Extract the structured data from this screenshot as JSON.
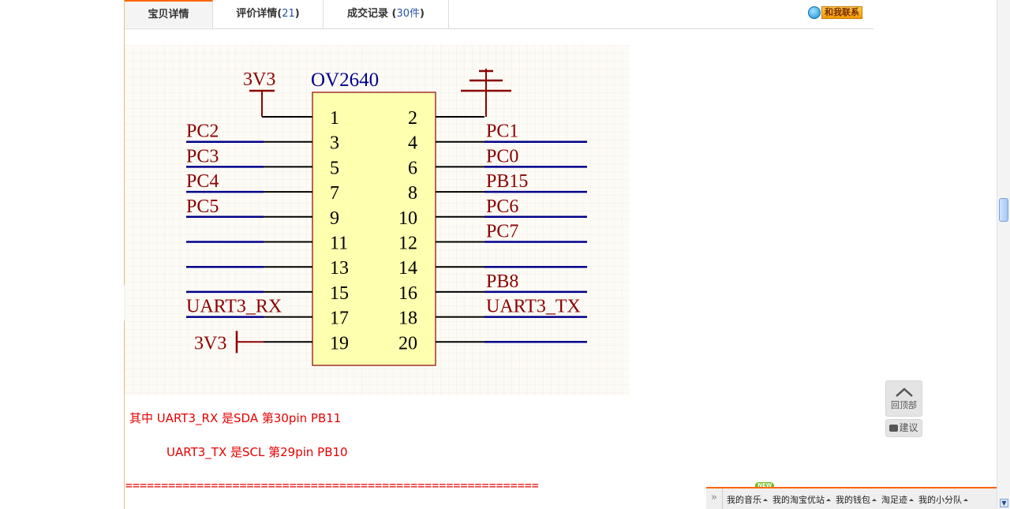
{
  "tabs": [
    {
      "label": "宝贝详情",
      "count": null,
      "suffix": ""
    },
    {
      "label": "评价详情(",
      "count": "21",
      "suffix": ")"
    },
    {
      "label": "成交记录 (",
      "count": "30件",
      "suffix": ")"
    }
  ],
  "contact_label": "和我联系",
  "schematic": {
    "component_name": "OV2640",
    "power_label_top": "3V3",
    "power_label_bottom": "3V3",
    "left_pins": [
      "1",
      "3",
      "5",
      "7",
      "9",
      "11",
      "13",
      "15",
      "17",
      "19"
    ],
    "right_pins": [
      "2",
      "4",
      "6",
      "8",
      "10",
      "12",
      "14",
      "16",
      "18",
      "20"
    ],
    "left_nets": [
      "PC2",
      "PC3",
      "PC4",
      "PC5",
      "UART3_RX"
    ],
    "right_nets": [
      "PC1",
      "PC0",
      "PB15",
      "PC6",
      "PC7",
      "PB8",
      "UART3_TX"
    ]
  },
  "notes": {
    "line1": "其中 UART3_RX 是SDA 第30pin PB11",
    "line2": "UART3_TX 是SCL 第29pin PB10",
    "separator": "=========================================================="
  },
  "back_to_top": "回顶部",
  "suggest": "建议",
  "bottom_bar": {
    "new_badge": "NEW",
    "items": [
      "我的音乐",
      "我的淘宝优站",
      "我的钱包",
      "淘足迹",
      "我的小分队"
    ]
  },
  "colors": {
    "accent": "#ff6600",
    "schematic_red": "#8b0000",
    "schematic_blue": "#00008b",
    "note_red": "#e60000"
  }
}
